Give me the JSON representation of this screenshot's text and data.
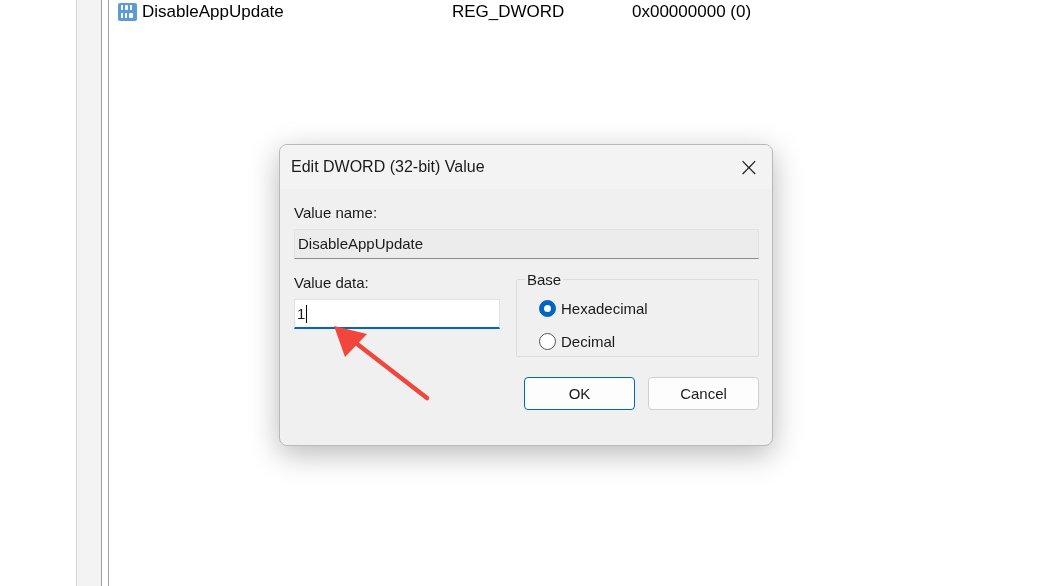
{
  "registry_rows": [
    {
      "name": "DisableAppUpdate",
      "type": "REG_DWORD",
      "data": "0x00000000 (0)",
      "selected": false
    }
  ],
  "dialog": {
    "title": "Edit DWORD (32-bit) Value",
    "close": "×",
    "value_name": {
      "label": "Value name:",
      "value": "DisableAppUpdate"
    },
    "value_data": {
      "label": "Value data:",
      "value": "1",
      "focused": true
    },
    "base": {
      "legend": "Base",
      "options": [
        {
          "label": "Hexadecimal",
          "selected": true
        },
        {
          "label": "Decimal",
          "selected": false
        }
      ]
    },
    "buttons": [
      {
        "label": "OK",
        "default": true
      },
      {
        "label": "Cancel",
        "default": false
      }
    ]
  },
  "annotation": {
    "kind": "arrow"
  }
}
